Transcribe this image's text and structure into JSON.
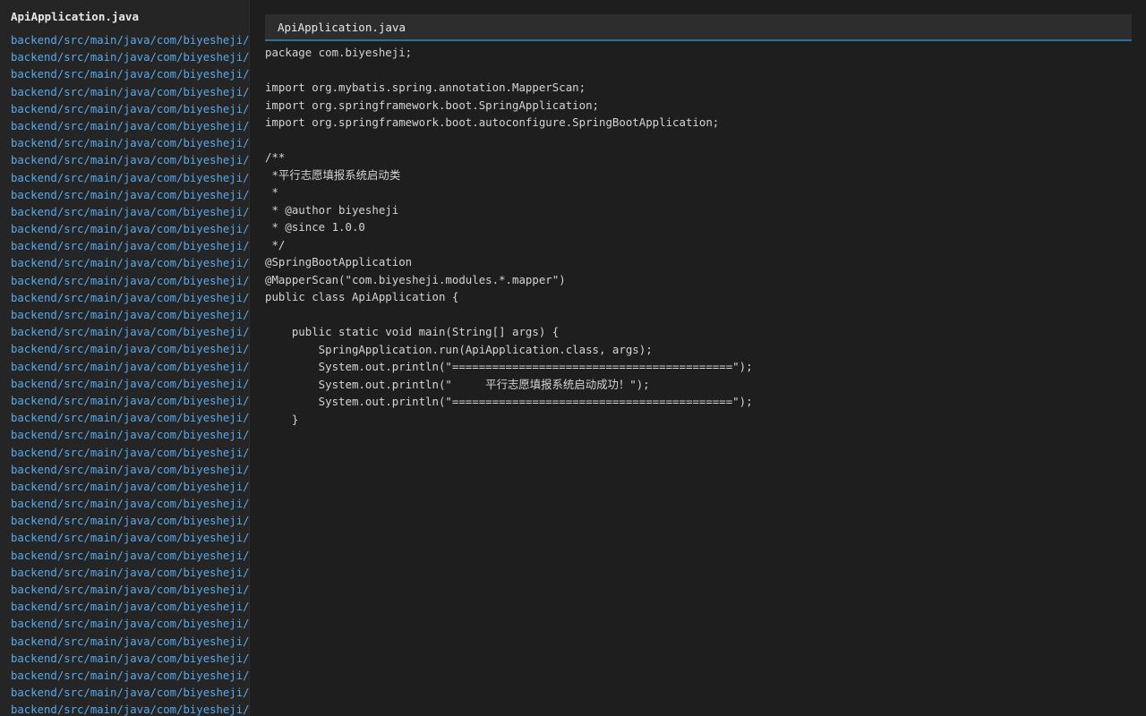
{
  "sidebar": {
    "title": "ApiApplication.java",
    "files": [
      "backend/src/main/java/com/biyesheji/A",
      "backend/src/main/java/com/biyesheji/c",
      "backend/src/main/java/com/biyesheji/c",
      "backend/src/main/java/com/biyesheji/c",
      "backend/src/main/java/com/biyesheji/c",
      "backend/src/main/java/com/biyesheji/c",
      "backend/src/main/java/com/biyesheji/c",
      "backend/src/main/java/com/biyesheji/c",
      "backend/src/main/java/com/biyesheji/c",
      "backend/src/main/java/com/biyesheji/c",
      "backend/src/main/java/com/biyesheji/c",
      "backend/src/main/java/com/biyesheji/c",
      "backend/src/main/java/com/biyesheji/c",
      "backend/src/main/java/com/biyesheji/c",
      "backend/src/main/java/com/biyesheji/c",
      "backend/src/main/java/com/biyesheji/c",
      "backend/src/main/java/com/biyesheji/c",
      "backend/src/main/java/com/biyesheji/c",
      "backend/src/main/java/com/biyesheji/c",
      "backend/src/main/java/com/biyesheji/c",
      "backend/src/main/java/com/biyesheji/c",
      "backend/src/main/java/com/biyesheji/c",
      "backend/src/main/java/com/biyesheji/c",
      "backend/src/main/java/com/biyesheji/c",
      "backend/src/main/java/com/biyesheji/c",
      "backend/src/main/java/com/biyesheji/c",
      "backend/src/main/java/com/biyesheji/c",
      "backend/src/main/java/com/biyesheji/c",
      "backend/src/main/java/com/biyesheji/c",
      "backend/src/main/java/com/biyesheji/m",
      "backend/src/main/java/com/biyesheji/m",
      "backend/src/main/java/com/biyesheji/m",
      "backend/src/main/java/com/biyesheji/m",
      "backend/src/main/java/com/biyesheji/m",
      "backend/src/main/java/com/biyesheji/m",
      "backend/src/main/java/com/biyesheji/m",
      "backend/src/main/java/com/biyesheji/m",
      "backend/src/main/java/com/biyesheji/m",
      "backend/src/main/java/com/biyesheji/m",
      "backend/src/main/java/com/biyesheji/m"
    ]
  },
  "editor": {
    "tab_title": "ApiApplication.java",
    "lines": [
      "package com.biyesheji;",
      "",
      "import org.mybatis.spring.annotation.MapperScan;",
      "import org.springframework.boot.SpringApplication;",
      "import org.springframework.boot.autoconfigure.SpringBootApplication;",
      "",
      "/**",
      " *平行志愿填报系统启动类",
      " *",
      " * @author biyesheji",
      " * @since 1.0.0",
      " */",
      "@SpringBootApplication",
      "@MapperScan(\"com.biyesheji.modules.*.mapper\")",
      "public class ApiApplication {",
      "",
      "    public static void main(String[] args) {",
      "        SpringApplication.run(ApiApplication.class, args);",
      "        System.out.println(\"==========================================\");",
      "        System.out.println(\"     平行志愿填报系统启动成功！\");",
      "        System.out.println(\"==========================================\");",
      "    }"
    ]
  }
}
